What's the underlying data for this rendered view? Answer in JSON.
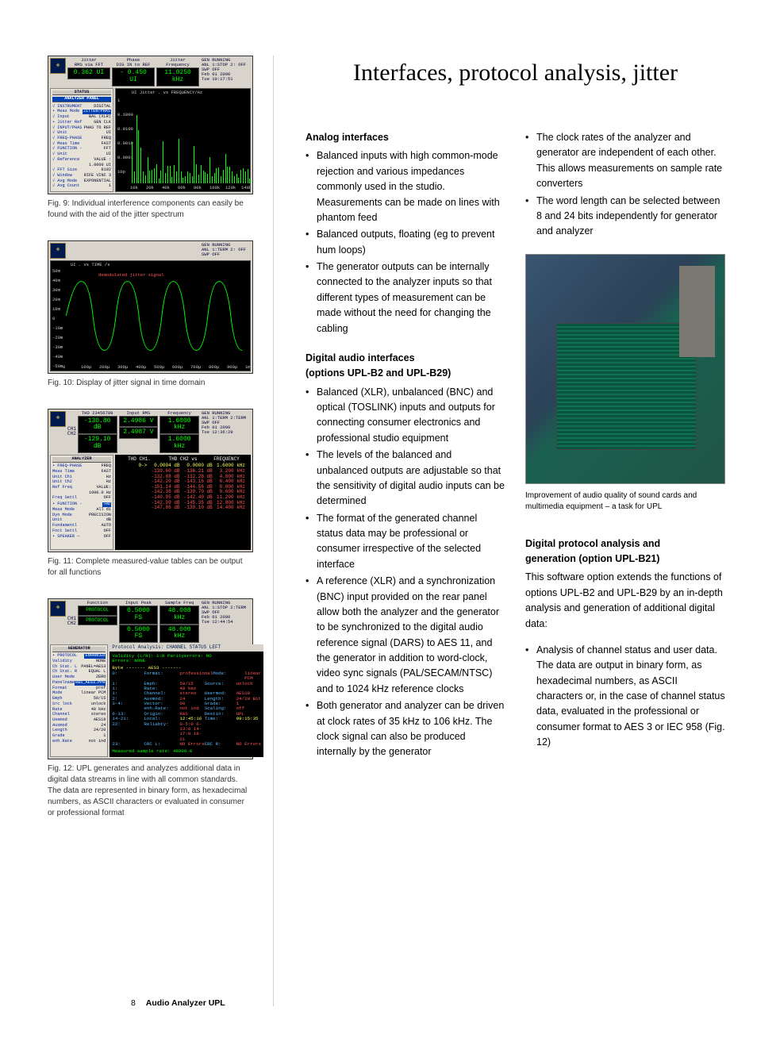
{
  "page": {
    "number": "8",
    "book_title": "Audio Analyzer UPL"
  },
  "title": "Interfaces, protocol analysis, jitter",
  "figures": {
    "fig9": {
      "caption": "Fig. 9: Individual interference components can easily be found with the aid of the jitter spectrum",
      "header": {
        "m1_label": "Jitter",
        "m1_sub": "RMS via FFT",
        "m1_val": "0.362 UI",
        "m2_label": "Phase",
        "m2_sub": "DIG IN to REF",
        "m2_val": "- 0.450 UI",
        "m3_label": "Jitter",
        "m3_sub": "Frequency",
        "m3_val": "11.0250 kHz",
        "status_line1": "GEN RUNNING",
        "status_line2": "ANL 1:STOP 2: OFF",
        "status_line3": "SWP OFF",
        "status_date": "Feb 01 2000",
        "status_time": "Tue 10:17:51"
      },
      "panel_title": "STATUS",
      "panel_sub": "ANALYZER PANEL",
      "rows": [
        {
          "k": "√ INSTRUMENT",
          "v": "DIGITAL"
        },
        {
          "k": "• Meas Mode",
          "v": "JITTER/PHAS",
          "hl": true
        },
        {
          "k": "√ Input",
          "v": "BAL  (XLR)"
        },
        {
          "k": "• Jitter Ref",
          "v": "GEN CLK"
        },
        {
          "k": "√ INPUT/PHAS",
          "v": "PHAS TO REF"
        },
        {
          "k": "√ Unit",
          "v": "UI"
        },
        {
          "k": "√ FREQ-PHASE",
          "v": "FREQ"
        },
        {
          "k": "√ Meas Time",
          "v": "FAST"
        },
        {
          "k": "√ FUNCTION -",
          "v": "FFT"
        },
        {
          "k": "√ Unit",
          "v": "UI"
        },
        {
          "k": "√ Reference",
          "v": "VALUE :"
        },
        {
          "k": "",
          "v": "1.0000 UI"
        },
        {
          "k": "√ FFT Size",
          "v": "8192"
        },
        {
          "k": "√ Window",
          "v": "RIFE VINC 3"
        },
        {
          "k": "√ Avg Mode",
          "v": "EXPONENTIAL"
        },
        {
          "k": "√ Avg Count",
          "v": "1"
        }
      ],
      "plot_title": "UI    Jitter .                  vs       FREQUENCY/Hz",
      "y_ticks": [
        "1",
        "0.1000",
        "0.0100",
        "0.0010",
        "0.0001",
        "10p"
      ],
      "x_ticks": [
        "10k",
        "20k",
        "40k",
        "60k",
        "80k",
        "100k",
        "120k",
        "140k"
      ]
    },
    "fig10": {
      "caption": "Fig. 10: Display of jitter signal in time domain",
      "header": {
        "status_line1": "GEN RUNNING",
        "status_line2": "ANL 1:TERM 2: OFF",
        "status_line3": "SWP OFF"
      },
      "plot_title": "UI                    .            vs       TIME    /s",
      "plot_label": "demodulated jitter signal",
      "y_ticks": [
        "50m",
        "40m",
        "30m",
        "20m",
        "10m",
        "0",
        "-10m",
        "-20m",
        "-30m",
        "-40m",
        "-50m"
      ],
      "x_ticks": [
        "0",
        "100µ",
        "200µ",
        "300µ",
        "400µ",
        "500µ",
        "600µ",
        "700µ",
        "800µ",
        "900µ",
        "1m"
      ]
    },
    "fig11": {
      "caption": "Fig. 11: Complete measured-value tables can be output for all functions",
      "header": {
        "ch1": "CH1",
        "ch1_val": "-130.80 dB",
        "ch2": "CH2",
        "ch2_val": "-129.10 dB",
        "m1_label": "THD 23456789",
        "m2_label": "Input RMS",
        "m2_val1": "2.4986  V",
        "m2_val2": "2.4987  V",
        "m3_label": "Frequency",
        "m3_val1": "1.6000 kHz",
        "m3_val2": "1.6000 kHz",
        "status_line1": "GEN RUNNING",
        "status_line2": "ANL 1:TERM 2:TERM",
        "status_line3": "SWP OFF",
        "status_date": "Feb 01 2000",
        "status_time": "Tue 12:36:29"
      },
      "panel_title": "ANALYZER",
      "rows": [
        {
          "k": "• FREQ-PHASE",
          "v": "FREQ"
        },
        {
          "k": "  Meas Time",
          "v": "FAST"
        },
        {
          "k": "  Unit Ch1",
          "v": "Hz"
        },
        {
          "k": "  Unit Ch2",
          "v": "Hz"
        },
        {
          "k": "  Ref Freq",
          "v": "VALUE:"
        },
        {
          "k": "",
          "v": "1000.0 Hz"
        },
        {
          "k": "  Freq Settl",
          "v": "OFF"
        },
        {
          "k": "",
          "v": ""
        },
        {
          "k": "• FUNCTION -",
          "v": "THD",
          "hl": true
        },
        {
          "k": "  Meas Mode",
          "v": "All di"
        },
        {
          "k": "  Dyn Mode",
          "v": "PRECISION"
        },
        {
          "k": "  Unit",
          "v": "dB"
        },
        {
          "k": "  Fundamentl",
          "v": "AUTO"
        },
        {
          "k": "  Fnct Settl",
          "v": "OFF"
        },
        {
          "k": "",
          "v": ""
        },
        {
          "k": "• SPEAKER  —",
          "v": "OFF"
        }
      ],
      "thead": [
        "THD   CH1.",
        "THD   CH2 vs",
        "FREQUENCY"
      ],
      "trows": [
        [
          "0->",
          "0.0004 dB",
          "0.0000 dB",
          "1.6000 kHz"
        ],
        [
          "",
          "-139.60 dB",
          "-136.21 dB",
          "3.200 kHz"
        ],
        [
          "",
          "-132.88 dB",
          "-132.28 dB",
          "4.800 kHz"
        ],
        [
          "",
          "-142.20 dB",
          "-143.16 dB",
          "6.400 kHz"
        ],
        [
          "",
          "-151.14 dB",
          "-144.56 dB",
          "8.000 kHz"
        ],
        [
          "",
          "-142.38 dB",
          "-139.70 dB",
          "9.600 kHz"
        ],
        [
          "",
          "-140.95 dB",
          "-142.40 dB",
          "11.200 kHz"
        ],
        [
          "",
          "-142.99 dB",
          "-145.35 dB",
          "12.800 kHz"
        ],
        [
          "",
          "-147.86 dB",
          "-139.10 dB",
          "14.400 kHz"
        ]
      ]
    },
    "fig12": {
      "caption": "Fig. 12: UPL generates and analyzes additional data in digital data streams in line with all common standards. The data are represented in binary form, as hexadecimal numbers, as ASCII characters or evaluated in consumer or professional format",
      "header": {
        "ch1": "CH1",
        "ch1_val": "PROTOCOL",
        "ch2": "CH2",
        "ch2_val": "PROTOCOL",
        "m1_label": "Function",
        "m2_label": "Input Peak",
        "m2_val1": "0.5000 FS",
        "m2_val2": "0.5000 FS",
        "m3_label": "Sample Freq",
        "m3_val1": "48.008 kHz",
        "m3_val2": "48.000 kHz",
        "status_line1": "GEN RUNNING",
        "status_line2": "ANL 1:STOP 2:TERM",
        "status_line3": "SWP OFF",
        "status_date": "Feb 01 2000",
        "status_time": "Tue 12:44:54"
      },
      "panel_title": "GENERATOR",
      "rows": [
        {
          "k": "• PROTOCOL",
          "v": "ENHANCED",
          "hl": true
        },
        {
          "k": "  Validity",
          "v": "NONE"
        },
        {
          "k": "  Ch Stat. L",
          "v": "PANEL=AES3"
        },
        {
          "k": "  Ch Stat. R",
          "v": "EQUAL L"
        },
        {
          "k": "  User Mode",
          "v": "ZERO"
        },
        {
          "k": "  Panelname",
          "v": "R&S_AES3.PPR",
          "hl": true
        },
        {
          "k": "   Format",
          "v": "prof"
        },
        {
          "k": "   Mode",
          "v": "linear PCM"
        },
        {
          "k": "   Emph",
          "v": "50/15"
        },
        {
          "k": "   Src lock",
          "v": "unlock"
        },
        {
          "k": "   Rate",
          "v": "48 kHz"
        },
        {
          "k": "   Channel",
          "v": "stereo"
        },
        {
          "k": "   Usemod",
          "v": "AES18"
        },
        {
          "k": "   Auxmod",
          "v": "24"
        },
        {
          "k": "   Length",
          "v": "24/20"
        },
        {
          "k": "   Grade",
          "v": "1"
        },
        {
          "k": "   enh.Rate",
          "v": "not ind"
        }
      ],
      "proto": {
        "title": "Protocol Analysis:  CHANNEL STATUS LEFT",
        "line1": "Validity (L/R): 1:N                     Parityerrors: NO",
        "line1b": "                                        Errors:  NONE",
        "byte_hdr": "Byte    -------        AES3     -------",
        "lines": [
          {
            "n": "0:",
            "a": "Format:",
            "av": "professional",
            "b": "Mode:",
            "bv": "linear PCM"
          },
          {
            "n": "1:",
            "a": "Emph:",
            "av": "50/15",
            "b": "Source:",
            "bv": "unlock"
          },
          {
            "n": "1:",
            "a": "Rate:",
            "av": "48 kHz",
            "b": "",
            "bv": ""
          },
          {
            "n": "1:",
            "a": "Channel:",
            "av": "stereo",
            "b": "Usermod:",
            "bv": "AES18"
          },
          {
            "n": "2:",
            "a": "Auxmod:",
            "av": "24",
            "b": "Length:",
            "bv": "24/20 Bit"
          },
          {
            "n": "3-4:",
            "a": "Vector:",
            "av": "00",
            "b": "Grade:",
            "bv": "1"
          },
          {
            "n": "",
            "a": "enh.Rate:",
            "av": "not ind",
            "b": "Scaling:",
            "bv": "off"
          },
          {
            "n": "6-13:",
            "a": "Origin:",
            "av": "R&S",
            "b": "Destin:",
            "bv": "UPL"
          },
          {
            "n": "14-21:",
            "a": "Local:",
            "av": "12:45:16",
            "b": "Time:",
            "bv": "09:15:35",
            "yellow": true
          },
          {
            "n": "22:",
            "a": "Reliabty:",
            "av": "0-5:0 6-13:0 14-17:0  18-21"
          },
          {
            "n": "23:",
            "a": "CRC L:",
            "av": "NO  Errors",
            "b": "CRC R:",
            "bv": "NO  Errors"
          }
        ],
        "footer": "Measured sample rate:     48000.0"
      }
    }
  },
  "photo_caption": "Improvement of audio quality of sound cards and multimedia equipment – a task for UPL",
  "content": {
    "h1": "Analog interfaces",
    "l1": [
      "Balanced inputs with high common-mode rejection and various impedances commonly used in the studio. Measurements can be made on lines with phantom feed",
      "Balanced outputs, floating (eg to prevent hum loops)",
      "The generator outputs can be internally connected to the analyzer inputs so that different types of measurement can be made without the need for changing the cabling"
    ],
    "h2a": "Digital audio interfaces",
    "h2b": "(options UPL-B2 and UPL-B29)",
    "l2": [
      "Balanced (XLR), unbalanced (BNC) and optical (TOSLINK) inputs and outputs for connecting consumer electronics and professional studio equipment",
      "The levels of the balanced and unbalanced outputs are adjustable so that the sensitivity of digital audio inputs can be determined",
      "The format of the generated channel status data may be professional or consumer irrespective of the selected interface",
      "A reference (XLR) and a synchronization (BNC) input provided on the rear panel allow both the analyzer and the generator to be synchronized to the digital audio reference signal (DARS) to AES 11, and the generator in addition to word-clock, video sync signals (PAL/SECAM/NTSC) and to 1024 kHz reference clocks",
      "Both generator and analyzer can be driven at clock rates of 35 kHz to 106 kHz. The clock signal can also be produced internally by the generator"
    ],
    "l2_right": [
      "The clock rates of the analyzer and generator are independent of each other. This allows measurements on sample rate converters",
      "The word length can be selected between 8 and 24 bits independently for generator and analyzer"
    ],
    "h3a": "Digital protocol analysis and",
    "h3b": "generation (option UPL-B21)",
    "p3": "This software option extends the functions of options UPL-B2 and UPL-B29 by an in-depth analysis and generation of additional digital data:",
    "l3": [
      "Analysis of channel status and user data. The data are output in binary form, as hexadecimal numbers, as ASCII characters or, in the case of channel status data, evaluated in the professional or consumer format to AES 3 or IEC 958 (Fig. 12)"
    ]
  }
}
